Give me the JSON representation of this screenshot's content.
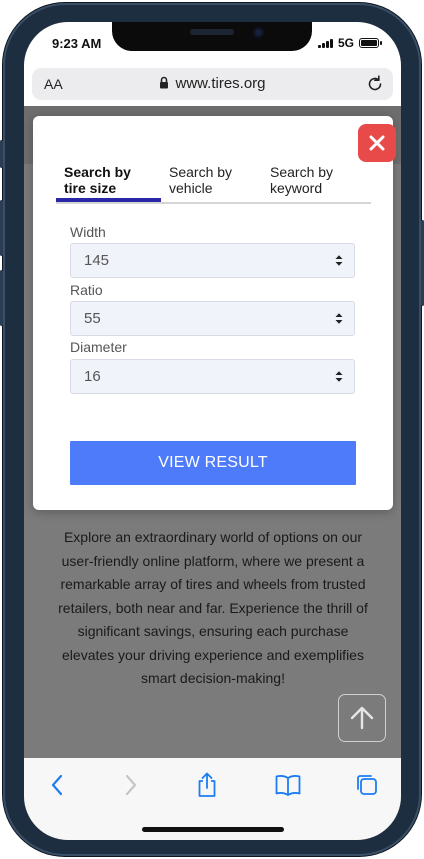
{
  "status_bar": {
    "time": "9:23 AM",
    "network": "5G"
  },
  "browser": {
    "text_size_label": "AA",
    "url": "www.tires.org"
  },
  "modal": {
    "tabs": [
      {
        "label": "Search by\ntire size",
        "active": true
      },
      {
        "label": "Search by\nvehicle",
        "active": false
      },
      {
        "label": "Search by\nkeyword",
        "active": false
      }
    ],
    "fields": [
      {
        "label": "Width",
        "value": "145"
      },
      {
        "label": "Ratio",
        "value": "55"
      },
      {
        "label": "Diameter",
        "value": "16"
      }
    ],
    "submit_label": "VIEW RESULT"
  },
  "content": {
    "paragraph": "Explore an extraordinary world of options on our user-friendly online platform, where we present a remarkable array of tires and wheels from trusted retailers, both near and far. Experience the thrill of significant savings, ensuring each purchase elevates your driving experience and exemplifies smart decision-making!"
  },
  "colors": {
    "close_button": "#e84a4a",
    "active_tab_underline": "#2a27a8",
    "primary_button": "#4d7bfa",
    "overlay": "#7b7b7b",
    "safari_blue": "#1e7cf2"
  },
  "icons": {
    "close": "close-icon",
    "back": "chevron-left-icon",
    "forward": "chevron-right-icon",
    "share": "share-icon",
    "bookmarks": "book-icon",
    "tabs": "tabs-icon",
    "scroll_top": "arrow-up-icon",
    "reload": "reload-icon",
    "lock": "lock-icon"
  }
}
